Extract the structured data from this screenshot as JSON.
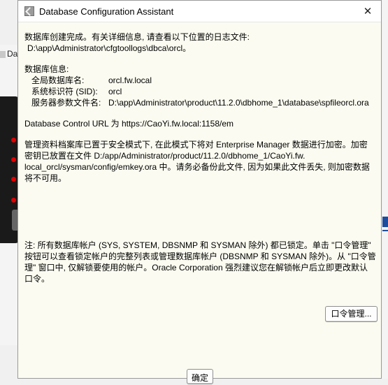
{
  "background": {
    "title_fragment": "Da"
  },
  "dialog": {
    "title": "Database Configuration Assistant",
    "close_glyph": "✕",
    "creation_done": "数据库创建完成。有关详细信息, 请查看以下位置的日志文件:",
    "log_path": "D:\\app\\Administrator\\cfgtoollogs\\dbca\\orcl。",
    "info_heading": "数据库信息:",
    "info": [
      {
        "key": "全局数据库名:",
        "value": "orcl.fw.local"
      },
      {
        "key": "系统标识符 (SID):",
        "value": "orcl"
      },
      {
        "key": "服务器参数文件名:",
        "value": "D:\\app\\Administrator\\product\\11.2.0\\dbhome_1\\database\\spfileorcl.ora"
      }
    ],
    "db_control_url": "Database Control URL 为 https://CaoYi.fw.local:1158/em",
    "em_lines": [
      "管理资料档案库已置于安全模式下, 在此模式下将对 Enterprise Manager 数据进行加密。加密",
      "密钥已放置在文件 D:/app/Administrator/product/11.2.0/dbhome_1/CaoYi.fw.",
      "local_orcl/sysman/config/emkey.ora 中。请务必备份此文件, 因为如果此文件丢失, 则加密数据",
      "将不可用。"
    ],
    "note_lines": [
      "注: 所有数据库帐户 (SYS, SYSTEM, DBSNMP 和 SYSMAN 除外) 都已锁定。单击 \"口令管理\"",
      "按钮可以查看锁定帐户的完整列表或管理数据库帐户 (DBSNMP 和 SYSMAN 除外)。从 \"口令管",
      "理\" 窗口中, 仅解锁要使用的帐户。Oracle Corporation 强烈建议您在解锁帐户后立即更改默认",
      "口令。"
    ],
    "password_button": "口令管理...",
    "ok_button": "确定"
  }
}
